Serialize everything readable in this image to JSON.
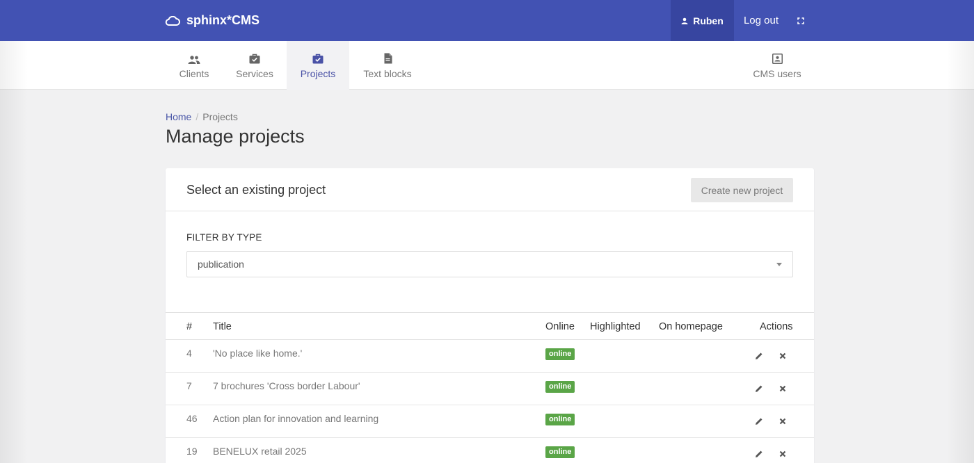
{
  "brand": {
    "name": "sphinx*CMS",
    "icon": "cloud-icon"
  },
  "topbar": {
    "user": "Ruben",
    "user_icon": "person-icon",
    "logout": "Log out",
    "fullscreen_icon": "fullscreen-icon"
  },
  "nav": {
    "items": [
      {
        "label": "Clients",
        "icon": "people-icon"
      },
      {
        "label": "Services",
        "icon": "briefcase-check-icon"
      },
      {
        "label": "Projects",
        "icon": "briefcase-check-icon",
        "active": true
      },
      {
        "label": "Text blocks",
        "icon": "document-icon"
      },
      {
        "label": "CMS users",
        "icon": "account-box-icon"
      }
    ]
  },
  "breadcrumb": {
    "home": "Home",
    "separator": "/",
    "current": "Projects"
  },
  "page_title": "Manage projects",
  "card": {
    "title": "Select an existing project",
    "create_button": "Create new project",
    "filter_label": "FILTER BY TYPE",
    "filter_value": "publication"
  },
  "table": {
    "headers": {
      "num": "#",
      "title": "Title",
      "online": "Online",
      "highlighted": "Highlighted",
      "homepage": "On homepage",
      "actions": "Actions"
    },
    "rows": [
      {
        "id": "4",
        "title": "'No place like home.'",
        "status": "online"
      },
      {
        "id": "7",
        "title": "7 brochures 'Cross border Labour'",
        "status": "online"
      },
      {
        "id": "46",
        "title": "Action plan for innovation and learning",
        "status": "online"
      },
      {
        "id": "19",
        "title": "BENELUX retail 2025",
        "status": "online"
      }
    ]
  },
  "colors": {
    "topbar": "#4252b3",
    "user_bg": "#3745a0",
    "active_nav": "#4a52a6",
    "badge": "#5aa547"
  }
}
